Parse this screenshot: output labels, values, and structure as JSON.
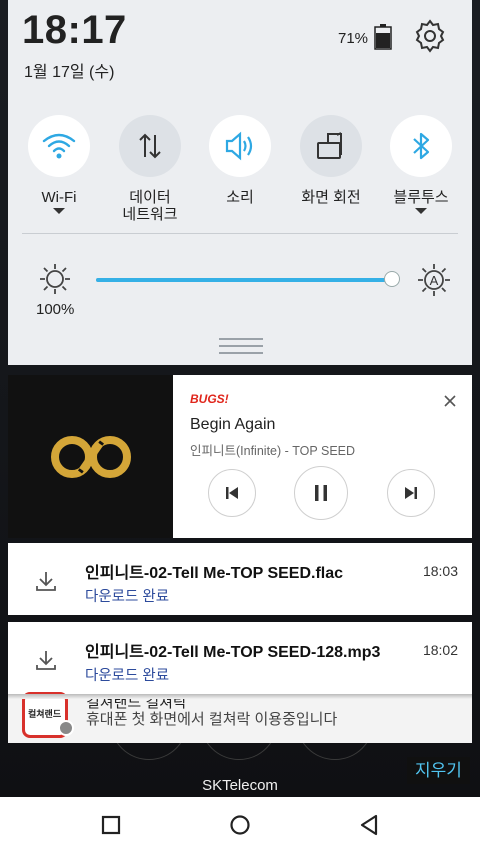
{
  "status": {
    "time": "18:17",
    "date": "1월 17일 (수)",
    "battery_percent": "71%"
  },
  "quick_settings": {
    "tiles": [
      {
        "label": "Wi-Fi",
        "icon": "wifi-icon",
        "active": true,
        "has_dropdown": true
      },
      {
        "label": "데이터\n네트워크",
        "icon": "data-network-icon",
        "active": false,
        "has_dropdown": false
      },
      {
        "label": "소리",
        "icon": "sound-icon",
        "active": true,
        "has_dropdown": false
      },
      {
        "label": "화면 회전",
        "icon": "screen-rotate-icon",
        "active": false,
        "has_dropdown": false
      },
      {
        "label": "블루투스",
        "icon": "bluetooth-icon",
        "active": true,
        "has_dropdown": true
      }
    ],
    "brightness": {
      "label": "100%",
      "level": 1.0
    }
  },
  "media": {
    "app": "BUGS!",
    "title": "Begin Again",
    "artist": "인피니트(Infinite) - TOP SEED",
    "controls": [
      "previous-icon",
      "pause-icon",
      "next-icon"
    ]
  },
  "downloads": [
    {
      "title": "인피니트-02-Tell Me-TOP SEED.flac",
      "status": "다운로드 완료",
      "time": "18:03"
    },
    {
      "title": "인피니트-02-Tell Me-TOP SEED-128.mp3",
      "status": "다운로드 완료",
      "time": "18:02"
    }
  ],
  "culture_notification": {
    "icon_label": "컬쳐랜드",
    "title": "컬쳐랜드 컬쳐락",
    "text": "휴대폰 첫 화면에서 컬쳐락 이용중입니다"
  },
  "carrier": "SKTelecom",
  "clear_label": "지우기",
  "colors": {
    "accent": "#35b0e6",
    "clear_text": "#51c4f0",
    "link_blue": "#2d4b9c"
  }
}
